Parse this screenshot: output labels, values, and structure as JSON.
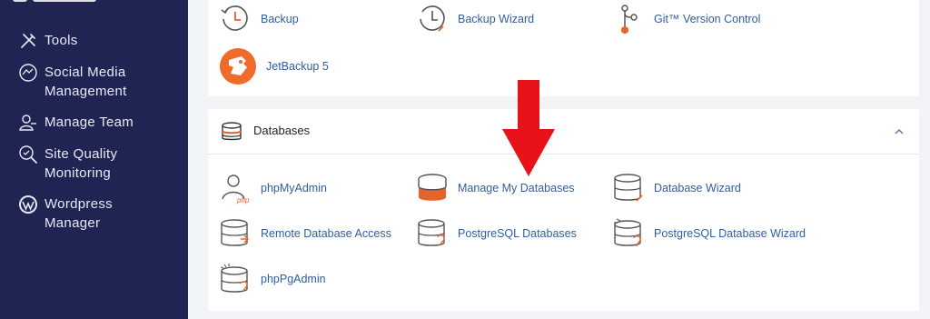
{
  "sidebar": {
    "items": [
      {
        "label": "Tools",
        "icon": "tools-icon"
      },
      {
        "label": "Social Media Management",
        "icon": "social-media-icon"
      },
      {
        "label": "Manage Team",
        "icon": "team-icon"
      },
      {
        "label": "Site Quality Monitoring",
        "icon": "site-quality-icon"
      },
      {
        "label": "Wordpress Manager",
        "icon": "wordpress-icon"
      }
    ]
  },
  "files_section": {
    "tools": [
      {
        "label": "Backup",
        "icon": "backup-icon"
      },
      {
        "label": "Backup Wizard",
        "icon": "backup-wizard-icon"
      },
      {
        "label": "Git™ Version Control",
        "icon": "git-icon"
      },
      {
        "label": "JetBackup 5",
        "icon": "jetbackup-icon"
      }
    ]
  },
  "databases_section": {
    "title": "Databases",
    "tools": [
      {
        "label": "phpMyAdmin",
        "icon": "phpmyadmin-icon"
      },
      {
        "label": "Manage My Databases",
        "icon": "manage-databases-icon"
      },
      {
        "label": "Database Wizard",
        "icon": "database-wizard-icon"
      },
      {
        "label": "Remote Database Access",
        "icon": "remote-database-icon"
      },
      {
        "label": "PostgreSQL Databases",
        "icon": "postgresql-icon"
      },
      {
        "label": "PostgreSQL Database Wizard",
        "icon": "postgresql-wizard-icon"
      },
      {
        "label": "phpPgAdmin",
        "icon": "phppgadmin-icon"
      }
    ]
  },
  "colors": {
    "sidebar_bg": "#1f2452",
    "link": "#2f5f9c",
    "accent_orange": "#e8632b",
    "arrow_red": "#e8121b"
  }
}
